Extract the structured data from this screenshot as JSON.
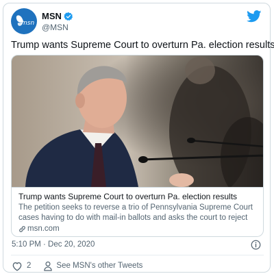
{
  "author": {
    "name": "MSN",
    "handle": "@MSN",
    "avatar_text": "msn"
  },
  "tweet": {
    "text": "Trump wants Supreme Court to overturn Pa. election results"
  },
  "card": {
    "title": "Trump wants Supreme Court to overturn Pa. election results",
    "description": "The petition seeks to reverse a trio of Pennsylvania Supreme Court cases having to do with mail-in ballots and asks the court to reject voters' will ...",
    "domain": "msn.com"
  },
  "meta": {
    "timestamp": "5:10 PM · Dec 20, 2020"
  },
  "actions": {
    "like_count": "2",
    "profile_link": "See MSN's other Tweets"
  },
  "icons": [
    "verified-badge-icon",
    "twitter-bird-icon",
    "link-icon",
    "info-icon",
    "heart-icon",
    "person-icon"
  ],
  "colors": {
    "twitter_blue": "#1d9bf0",
    "msn_blue": "#1f72be",
    "secondary_text": "#536471",
    "border": "#cfd9de"
  }
}
